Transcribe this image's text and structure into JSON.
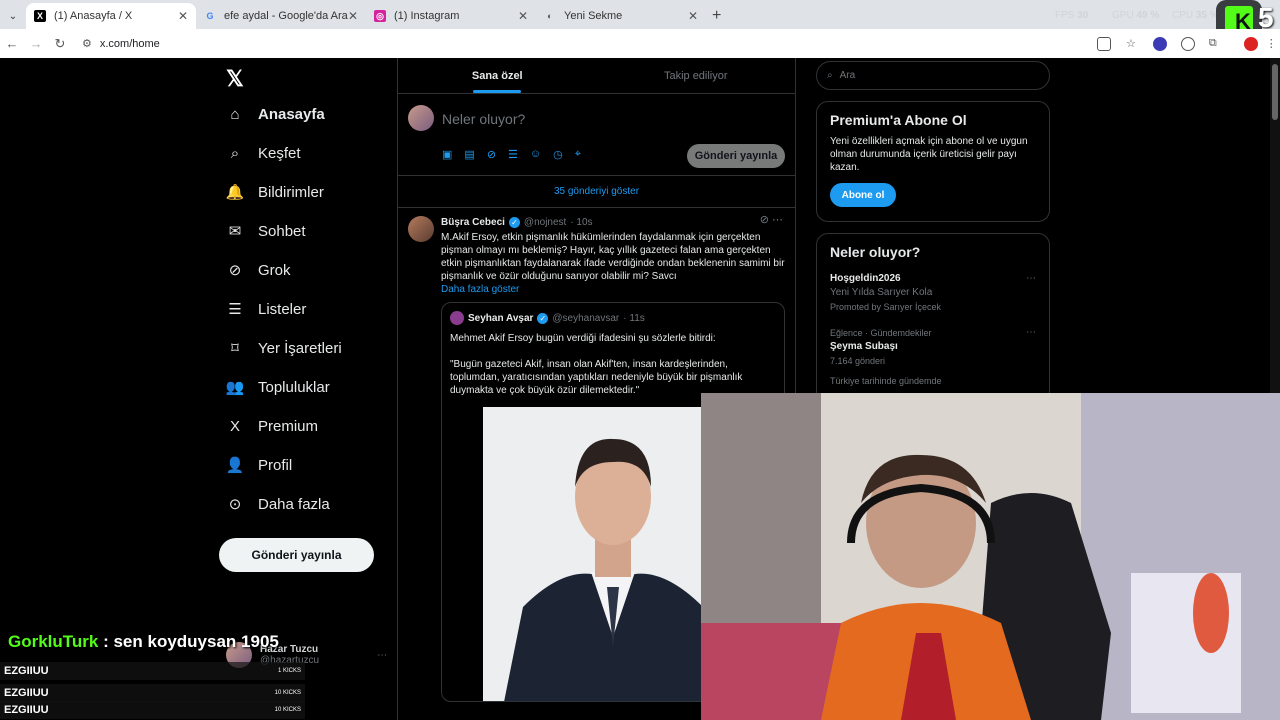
{
  "browser": {
    "tabs": [
      {
        "title": "(1) Anasayfa / X",
        "fav": "X",
        "active": true
      },
      {
        "title": "efe aydal - Google'da Ara",
        "fav": "G"
      },
      {
        "title": "(1) Instagram",
        "fav": "◎"
      },
      {
        "title": "Yeni Sekme",
        "fav": "◐"
      }
    ],
    "url": "x.com/home",
    "perf": {
      "fps_label": "FPS",
      "fps": "30",
      "gpu_label": "GPU",
      "gpu": "49 %",
      "cpu_label": "CPU",
      "cpu": "35 %"
    },
    "overlay_number": "5"
  },
  "sidebar": {
    "items": [
      {
        "label": "Anasayfa",
        "icon": "home-icon",
        "glyph": "⌂"
      },
      {
        "label": "Keşfet",
        "icon": "search-icon",
        "glyph": "⌕"
      },
      {
        "label": "Bildirimler",
        "icon": "bell-icon",
        "glyph": "🔔"
      },
      {
        "label": "Sohbet",
        "icon": "mail-icon",
        "glyph": "✉"
      },
      {
        "label": "Grok",
        "icon": "grok-icon",
        "glyph": "⊘"
      },
      {
        "label": "Listeler",
        "icon": "list-icon",
        "glyph": "☰"
      },
      {
        "label": "Yer İşaretleri",
        "icon": "bookmark-icon",
        "glyph": "⌑"
      },
      {
        "label": "Topluluklar",
        "icon": "community-icon",
        "glyph": "👥"
      },
      {
        "label": "Premium",
        "icon": "x-premium-icon",
        "glyph": "X"
      },
      {
        "label": "Profil",
        "icon": "profile-icon",
        "glyph": "👤"
      },
      {
        "label": "Daha fazla",
        "icon": "more-circle-icon",
        "glyph": "⊙"
      }
    ],
    "post_button": "Gönderi yayınla",
    "bottom_user": {
      "name": "Hazar Tuzcu",
      "handle": "@hazartuzcu"
    }
  },
  "feed": {
    "tabs": [
      "Sana özel",
      "Takip ediliyor"
    ],
    "compose_placeholder": "Neler oluyor?",
    "publish_button": "Gönderi yayınla",
    "show_new": "35 gönderiyi göster",
    "tweet": {
      "name": "Büşra Cebeci",
      "handle": "@nojnest",
      "time": "· 10s",
      "text": "M.Akif Ersoy, etkin pişmanlık hükümlerinden faydalanmak için gerçekten pişman olmayı mı beklemiş? Hayır, kaç yıllık gazeteci falan ama gerçekten etkin pişmanlıktan faydalanarak ifade verdiğinde ondan beklenenin samimi bir pişmanlık ve özür olduğunu sanıyor olabilir mi? Savcı",
      "show_more": "Daha fazla göster",
      "quote": {
        "name": "Seyhan Avşar",
        "handle": "@seyhanavsar",
        "time": "· 11s",
        "line1": "Mehmet Akif Ersoy bugün verdiği ifadesini şu sözlerle bitirdi:",
        "line2": "\"Bugün gazeteci Akif, insan olan Akif'ten, insan kardeşlerinden, toplumdan, yaratıcısından yaptıkları nedeniyle büyük bir pişmanlık duymakta ve çok büyük özür dilemektedir.\""
      }
    }
  },
  "right": {
    "search_placeholder": "Ara",
    "premium": {
      "title": "Premium'a Abone Ol",
      "text": "Yeni özellikleri açmak için abone ol ve uygun olman durumunda içerik üreticisi gelir payı kazan.",
      "button": "Abone ol"
    },
    "trends_title": "Neler oluyor?",
    "trends": [
      {
        "top": "",
        "title": "Hoşgeldin2026",
        "sub": "Yeni Yılda Sarıyer Kola",
        "extra": "Promoted by Sarıyer İçecek"
      },
      {
        "top": "Eğlence · Gündemdekiler",
        "title": "Şeyma Subaşı",
        "sub": "7.164 gönderi",
        "extra": ""
      }
    ],
    "trend3_top": "Türkiye tarihinde gündemde"
  },
  "stream": {
    "chat_user": "GorkluTurk",
    "chat_msg": " : sen koyduysan 1905",
    "kicks": [
      {
        "user": "EZGIIUU",
        "amount": "1 KICKS"
      },
      {
        "user": "EZGIIUU",
        "amount": "10 KICKS"
      },
      {
        "user": "EZGIIUU",
        "amount": "10 KICKS"
      }
    ]
  }
}
